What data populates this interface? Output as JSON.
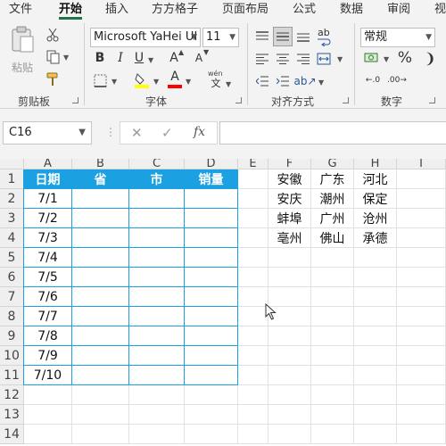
{
  "menu": {
    "tabs": [
      "文件",
      "开始",
      "插入",
      "方方格子",
      "页面布局",
      "公式",
      "数据",
      "审阅",
      "视"
    ],
    "active": "开始"
  },
  "ribbon": {
    "clipboard": {
      "paste_label": "粘贴",
      "group_label": "剪贴板"
    },
    "font": {
      "name": "Microsoft YaHei UI",
      "size": "11",
      "bold": "B",
      "italic": "I",
      "underline": "U",
      "grow": "A",
      "shrink": "A",
      "font_color_glyph": "A",
      "wen": "wén",
      "group_label": "字体",
      "fill_color": "#ffff00",
      "font_color": "#ff0000"
    },
    "alignment": {
      "wrap_glyph": "ab",
      "group_label": "对齐方式"
    },
    "number": {
      "format": "常规",
      "percent": "%",
      "group_label": "数字"
    }
  },
  "formula_bar": {
    "name_box": "C16",
    "fx": "fx",
    "content": ""
  },
  "grid": {
    "columns": [
      "A",
      "B",
      "C",
      "D",
      "E",
      "F",
      "G",
      "H",
      "I"
    ],
    "rows": [
      "1",
      "2",
      "3",
      "4",
      "5",
      "6",
      "7",
      "8",
      "9",
      "10",
      "11",
      "12",
      "13",
      "14"
    ],
    "table_header": [
      "日期",
      "省",
      "市",
      "销量"
    ],
    "dates": [
      "7/1",
      "7/2",
      "7/3",
      "7/4",
      "7/5",
      "7/6",
      "7/7",
      "7/8",
      "7/9",
      "7/10"
    ],
    "lookup": [
      [
        "安徽",
        "广东",
        "河北"
      ],
      [
        "安庆",
        "潮州",
        "保定"
      ],
      [
        "蚌埠",
        "广州",
        "沧州"
      ],
      [
        "亳州",
        "佛山",
        "承德"
      ]
    ],
    "header_color": "#1ba1e2"
  }
}
